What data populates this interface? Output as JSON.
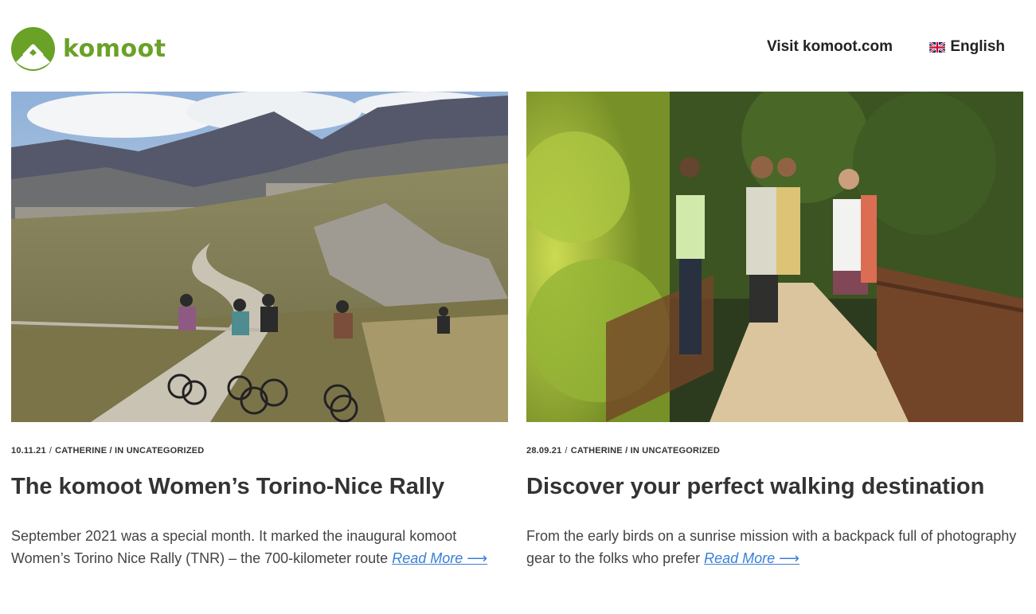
{
  "header": {
    "logo_text": "komoot",
    "visit_link": "Visit komoot.com",
    "language": "English",
    "brand_color": "#6aa127"
  },
  "posts": [
    {
      "date": "10.11.21",
      "author": "CATHERINE",
      "category_prefix": "/ IN",
      "category": "UNCATEGORIZED",
      "title": "The komoot Women’s Torino-Nice Rally",
      "excerpt": "September 2021 was a special month. It marked the inaugural komoot Women’s Torino Nice Rally (TNR) – the 700-kilometer route",
      "read_more": "Read More ⟶",
      "image_icon": "mountain-cyclists-photo"
    },
    {
      "date": "28.09.21",
      "author": "CATHERINE",
      "category_prefix": "/ IN",
      "category": "UNCATEGORIZED",
      "title": "Discover your perfect walking destination",
      "excerpt": "From the early birds on a sunrise mission with a backpack full of photography gear to the folks who prefer",
      "read_more": "Read More ⟶",
      "image_icon": "forest-hikers-photo"
    }
  ]
}
